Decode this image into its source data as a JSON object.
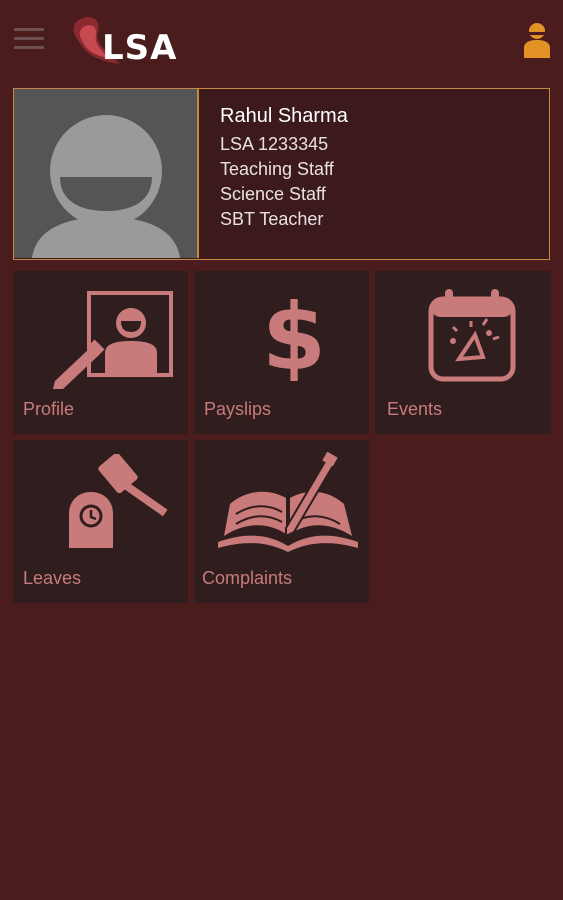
{
  "app": {
    "logo_text": "LSA"
  },
  "profile": {
    "name": "Rahul Sharma",
    "id": "LSA 1233345",
    "category": "Teaching Staff",
    "department": "Science Staff",
    "designation": "SBT Teacher"
  },
  "tiles": [
    {
      "label": "Profile",
      "icon": "profile-edit-icon"
    },
    {
      "label": "Payslips",
      "icon": "dollar-icon"
    },
    {
      "label": "Events",
      "icon": "calendar-party-icon"
    },
    {
      "label": "Leaves",
      "icon": "gavel-clock-icon"
    },
    {
      "label": "Complaints",
      "icon": "book-pen-icon"
    }
  ],
  "colors": {
    "background": "#4a1c1e",
    "tile": "#301e1f",
    "accent": "#c48a45",
    "icon": "#c97a7a",
    "user_icon": "#e39226"
  }
}
